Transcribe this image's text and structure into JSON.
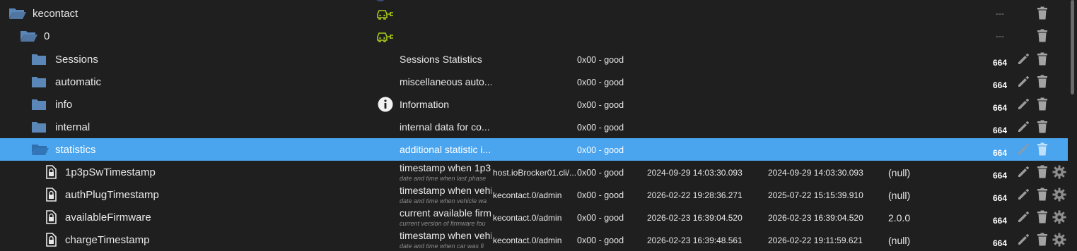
{
  "colors": {
    "background": "#1f1f1f",
    "selected_row": "#4aa4ee",
    "folder": "#5b86b8",
    "adapter_icon": "#a8c81c"
  },
  "tree": [
    {
      "type": "open-folder",
      "name": "kecontact",
      "role_icon": "adapter-icon",
      "desc": "",
      "desc_sub": "",
      "from": "",
      "status": "",
      "timestamp": "",
      "last_change": "",
      "value": "",
      "acl": "---",
      "edit": false,
      "delete": true,
      "settings": false
    },
    {
      "type": "open-folder",
      "name": "0",
      "role_icon": "adapter-icon",
      "desc": "",
      "desc_sub": "",
      "from": "",
      "status": "",
      "timestamp": "",
      "last_change": "",
      "value": "",
      "acl": "---",
      "edit": false,
      "delete": true,
      "settings": false
    },
    {
      "type": "folder",
      "name": "Sessions",
      "role_icon": "",
      "desc": "Sessions Statistics",
      "desc_sub": "",
      "from": "",
      "status": "0x00 - good",
      "timestamp": "",
      "last_change": "",
      "value": "",
      "acl": "664",
      "edit": true,
      "delete": true,
      "settings": false
    },
    {
      "type": "folder",
      "name": "automatic",
      "role_icon": "",
      "desc": "miscellaneous auto...",
      "desc_sub": "",
      "from": "",
      "status": "0x00 - good",
      "timestamp": "",
      "last_change": "",
      "value": "",
      "acl": "664",
      "edit": true,
      "delete": true,
      "settings": false
    },
    {
      "type": "folder",
      "name": "info",
      "role_icon": "info-icon",
      "desc": "Information",
      "desc_sub": "",
      "from": "",
      "status": "0x00 - good",
      "timestamp": "",
      "last_change": "",
      "value": "",
      "acl": "664",
      "edit": true,
      "delete": true,
      "settings": false
    },
    {
      "type": "folder",
      "name": "internal",
      "role_icon": "",
      "desc": "internal data for co...",
      "desc_sub": "",
      "from": "",
      "status": "0x00 - good",
      "timestamp": "",
      "last_change": "",
      "value": "",
      "acl": "664",
      "edit": true,
      "delete": true,
      "settings": false
    },
    {
      "type": "open-folder",
      "name": "statistics",
      "role_icon": "",
      "desc": "additional statistic i...",
      "desc_sub": "",
      "from": "",
      "status": "0x00 - good",
      "timestamp": "",
      "last_change": "",
      "value": "",
      "acl": "664",
      "edit": true,
      "delete": true,
      "settings": false,
      "selected": true
    },
    {
      "type": "state",
      "name": "1p3pSwTimestamp",
      "role_icon": "",
      "desc": "timestamp when 1p3",
      "desc_sub": "date and time when last phase",
      "from": "host.ioBrocker01.cli/...",
      "status": "0x00 - good",
      "timestamp": "2024-09-29 14:03:30.093",
      "last_change": "2024-09-29 14:03:30.093",
      "value": "(null)",
      "acl": "664",
      "edit": true,
      "delete": true,
      "settings": true
    },
    {
      "type": "state",
      "name": "authPlugTimestamp",
      "role_icon": "",
      "desc": "timestamp when vehi",
      "desc_sub": "date and time when vehicle wa",
      "from": "kecontact.0/admin",
      "status": "0x00 - good",
      "timestamp": "2026-02-22 19:28:36.271",
      "last_change": "2025-07-22 15:15:39.910",
      "value": "(null)",
      "acl": "664",
      "edit": true,
      "delete": true,
      "settings": true
    },
    {
      "type": "state",
      "name": "availableFirmware",
      "role_icon": "",
      "desc": "current available firm",
      "desc_sub": "current version of firmware fou",
      "from": "kecontact.0/admin",
      "status": "0x00 - good",
      "timestamp": "2026-02-23 16:39:04.520",
      "last_change": "2026-02-23 16:39:04.520",
      "value": "2.0.0",
      "acl": "664",
      "edit": true,
      "delete": true,
      "settings": true
    },
    {
      "type": "state",
      "name": "chargeTimestamp",
      "role_icon": "",
      "desc": "timestamp when vehi",
      "desc_sub": "date and time when car was fi",
      "from": "kecontact.0/admin",
      "status": "0x00 - good",
      "timestamp": "2026-02-23 16:39:48.561",
      "last_change": "2026-02-22 19:11:59.621",
      "value": "(null)",
      "acl": "664",
      "edit": true,
      "delete": true,
      "settings": true
    }
  ]
}
